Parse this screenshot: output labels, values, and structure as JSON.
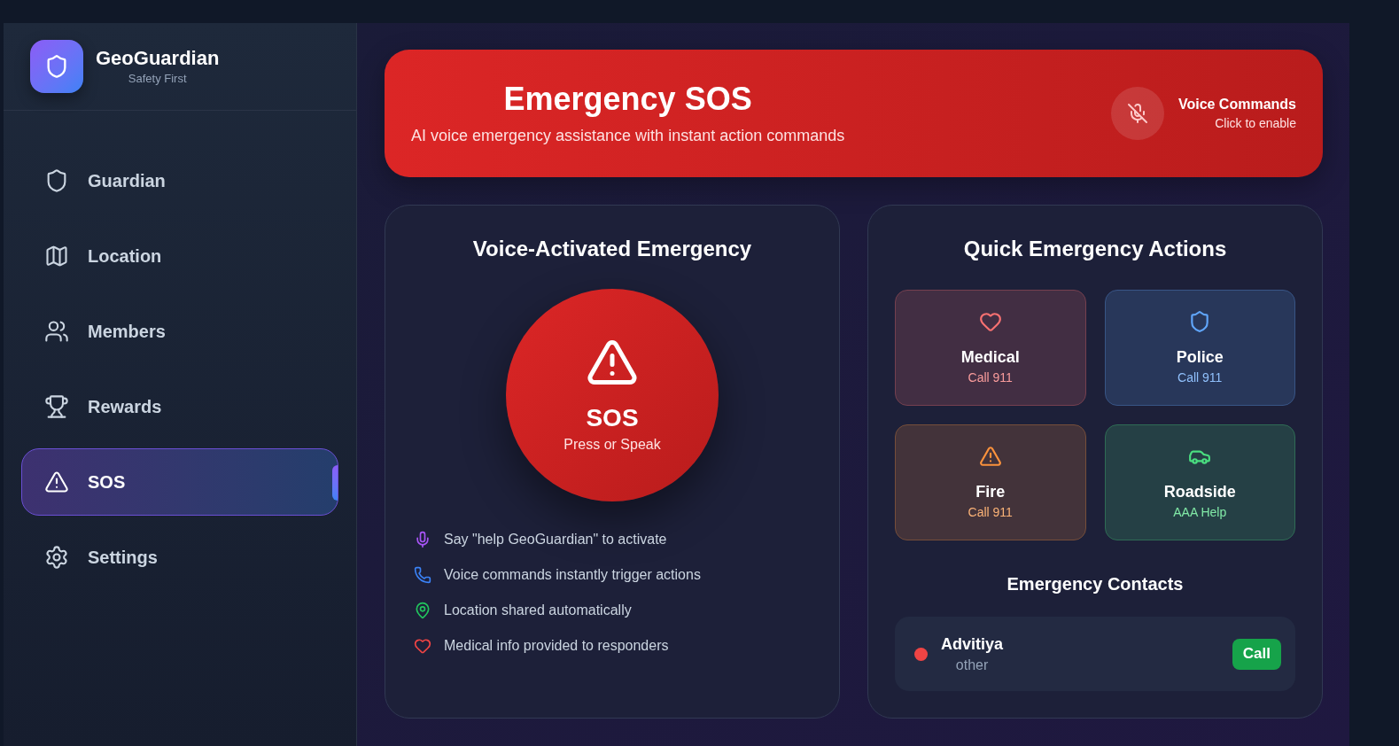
{
  "sidebar": {
    "app_name": "GeoGuardian",
    "tagline": "Safety First",
    "items": [
      {
        "label": "Guardian",
        "selected": false
      },
      {
        "label": "Location",
        "selected": false
      },
      {
        "label": "Members",
        "selected": false
      },
      {
        "label": "Rewards",
        "selected": false
      },
      {
        "label": "SOS",
        "selected": true
      },
      {
        "label": "Settings",
        "selected": false
      }
    ]
  },
  "header": {
    "title": "Emergency SOS",
    "subtitle": "AI voice emergency assistance with instant action commands",
    "voice": {
      "label": "Voice Commands",
      "hint": "Click to enable",
      "enabled": false
    }
  },
  "voice_panel": {
    "title": "Voice-Activated Emergency",
    "sos_button": {
      "label": "SOS",
      "hint": "Press or Speak"
    },
    "features": [
      {
        "text": "Say \"help GeoGuardian\" to activate",
        "color": "#a855f7"
      },
      {
        "text": "Voice commands instantly trigger actions",
        "color": "#3b82f6"
      },
      {
        "text": "Location shared automatically",
        "color": "#22c55e"
      },
      {
        "text": "Medical info provided to responders",
        "color": "#ef4444"
      }
    ]
  },
  "actions_panel": {
    "title": "Quick Emergency Actions",
    "actions": [
      {
        "title": "Medical",
        "subtitle": "Call 911",
        "color": "#f87171"
      },
      {
        "title": "Police",
        "subtitle": "Call 911",
        "color": "#60a5fa"
      },
      {
        "title": "Fire",
        "subtitle": "Call 911",
        "color": "#fb923c"
      },
      {
        "title": "Roadside",
        "subtitle": "AAA Help",
        "color": "#4ade80"
      }
    ],
    "contacts_title": "Emergency Contacts",
    "contacts": [
      {
        "name": "Advitiya",
        "relation": "other",
        "color": "#ef4444",
        "button": "Call"
      }
    ]
  }
}
